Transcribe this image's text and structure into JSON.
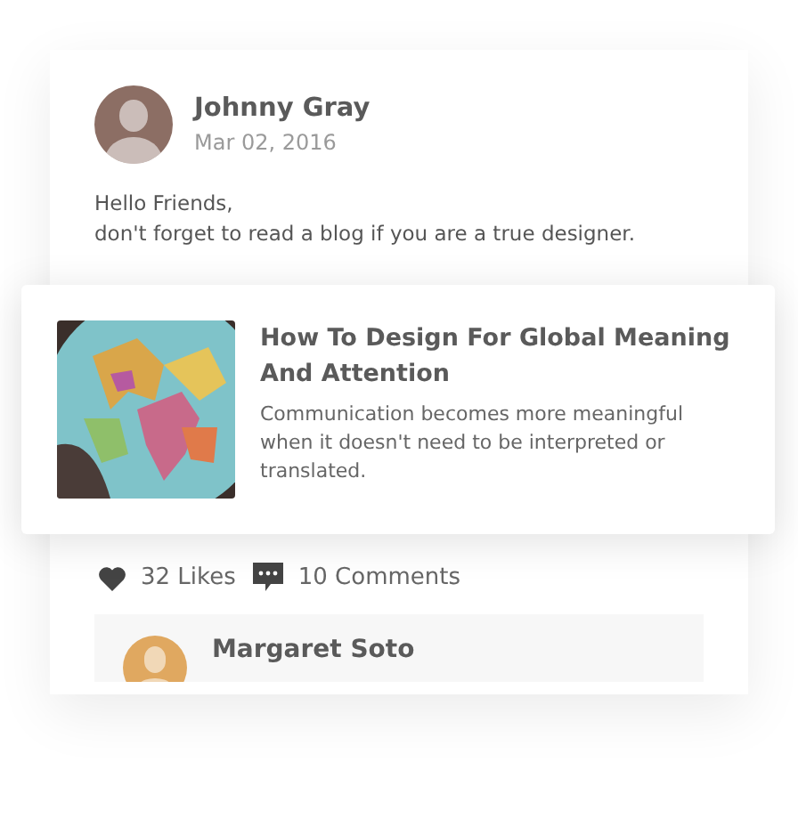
{
  "post": {
    "author": "Johnny Gray",
    "date": "Mar 02, 2016",
    "message_lines": [
      "Hello Friends,",
      "don't forget to read a blog if you are a true designer."
    ]
  },
  "article": {
    "title": "How To Design For Global Meaning And Attention",
    "summary": "Communication becomes more meaningful when it doesn't need to be interpreted or translated."
  },
  "stats": {
    "likes": "32 Likes",
    "comments": "10 Comments"
  },
  "comment": {
    "author": "Margaret Soto"
  }
}
